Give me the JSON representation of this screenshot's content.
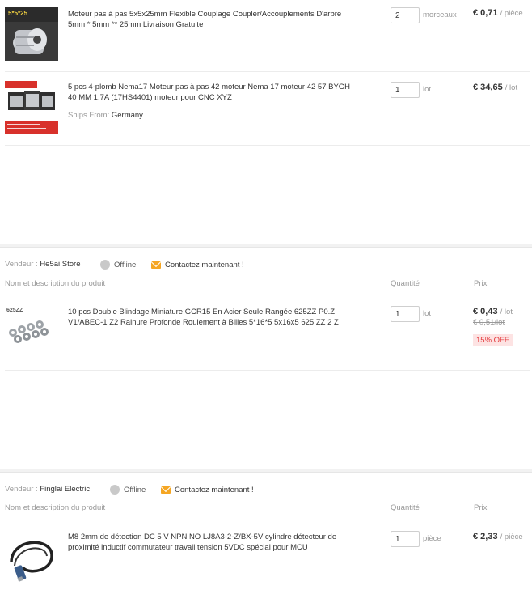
{
  "items": [
    {
      "title": "Moteur pas à pas 5x5x25mm Flexible Couplage Coupler/Accouplements D'arbre 5mm * 5mm ** 25mm Livraison Gratuite",
      "qty": "2",
      "unit": "morceaux",
      "price": "€ 0,71",
      "per": "/ pièce",
      "image_label": "5*5*25"
    },
    {
      "title": "5 pcs 4-plomb Nema17 Moteur pas à pas 42 moteur Nema 17 moteur 42 57 BYGH 40 MM 1.7A (17HS4401) moteur pour CNC XYZ",
      "qty": "1",
      "unit": "lot",
      "price": "€ 34,65",
      "per": "/ lot",
      "ships_label": "Ships From:",
      "ships_value": "Germany"
    },
    {
      "title": "10 pcs Double Blindage Miniature GCR15 En Acier Seule Rangée 625ZZ P0.Z V1/ABEC-1 Z2 Rainure Profonde Roulement à Billes 5*16*5 5x16x5 625 ZZ 2 Z",
      "qty": "1",
      "unit": "lot",
      "price": "€ 0,43",
      "per": "/ lot",
      "old_price": "€ 0,51/lot",
      "discount": "15% OFF",
      "image_label": "625ZZ"
    },
    {
      "title": "M8 2mm de détection DC 5 V NPN NO LJ8A3-2-Z/BX-5V cylindre détecteur de proximité inductif commutateur travail tension 5VDC spécial pour MCU",
      "qty": "1",
      "unit": "pièce",
      "price": "€ 2,33",
      "per": "/ pièce"
    }
  ],
  "vendors": [
    {
      "label": "Vendeur :",
      "name": "He5ai Store",
      "status": "Offline",
      "contact": "Contactez maintenant !"
    },
    {
      "label": "Vendeur :",
      "name": "Finglai Electric",
      "status": "Offline",
      "contact": "Contactez maintenant !"
    }
  ],
  "columns": {
    "product": "Nom et description du produit",
    "quantity": "Quantité",
    "price": "Prix"
  }
}
